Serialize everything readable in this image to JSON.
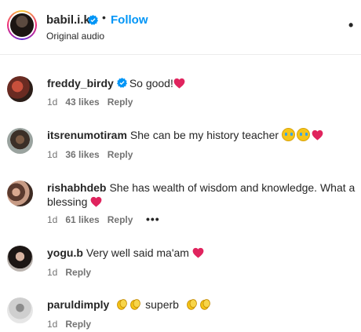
{
  "header": {
    "username": "babil.i.k",
    "follow_label": "Follow",
    "separator": "•",
    "subtitle": "Original audio",
    "more": "•"
  },
  "colors": {
    "accent": "#0095f6",
    "verified": "#0095f6",
    "heart": "#e0245e",
    "muted": "#737373"
  },
  "comments": [
    {
      "user": "freddy_birdy",
      "verified": true,
      "text": "So good!",
      "emoji": [
        "red-heart"
      ],
      "time": "1d",
      "likes": "43 likes",
      "reply": "Reply"
    },
    {
      "user": "itsrenumotiram",
      "text": "She can be my history teacher",
      "emoji": [
        "crying-face",
        "crying-face",
        "red-heart"
      ],
      "time": "1d",
      "likes": "36 likes",
      "reply": "Reply"
    },
    {
      "user": "rishabhdeb",
      "text": "She has wealth of wisdom and knowledge. What a",
      "text2": "blessing",
      "emoji": [
        "red-heart"
      ],
      "time": "1d",
      "likes": "61 likes",
      "reply": "Reply",
      "more": "•••"
    },
    {
      "user": "yogu.b",
      "text": "Very well said ma'am",
      "emoji": [
        "red-heart"
      ],
      "time": "1d",
      "reply": "Reply"
    },
    {
      "user": "paruldimply",
      "text": "superb",
      "emoji": [
        "clapping-hands",
        "clapping-hands",
        "clapping-hands",
        "clapping-hands"
      ],
      "time": "1d",
      "reply": "Reply"
    }
  ]
}
